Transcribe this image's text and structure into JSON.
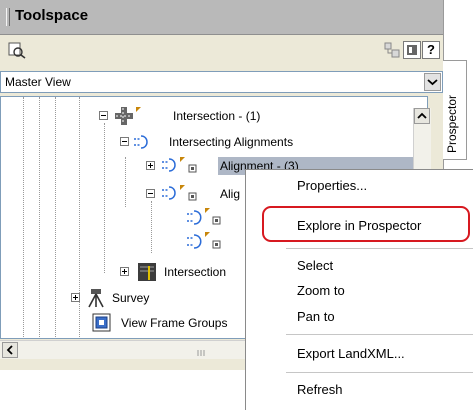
{
  "window": {
    "title": "Toolspace"
  },
  "toolbar": {
    "items": [
      "find-icon",
      "drawing-item-icon",
      "panel-icon",
      "help-icon"
    ],
    "help_label": "?"
  },
  "view_select": {
    "value": "Master View"
  },
  "tabs": {
    "prospector": "Prospector"
  },
  "tree": {
    "items": [
      {
        "label": "Intersection - (1)",
        "icon": "intersection-icon"
      },
      {
        "label": "Intersecting Alignments",
        "icon": "alignment-group-icon"
      },
      {
        "label": "Alignment - (3)",
        "icon": "alignment-icon"
      },
      {
        "label": "Alig",
        "icon": "alignment-icon"
      },
      {
        "label": "",
        "icon": "alignment-icon"
      },
      {
        "label": "",
        "icon": "alignment-icon"
      },
      {
        "label": "Intersection",
        "icon": "intersection-corridor-icon"
      },
      {
        "label": "Survey",
        "icon": "survey-icon"
      },
      {
        "label": "View Frame Groups",
        "icon": "view-frame-icon"
      }
    ]
  },
  "context_menu": {
    "items": [
      "Properties...",
      "Explore in Prospector",
      "Select",
      "Zoom to",
      "Pan to",
      "Export LandXML...",
      "Refresh"
    ],
    "highlighted": "Explore in Prospector"
  },
  "colors": {
    "highlight_border": "#d71920",
    "selection": "#aeb7c6",
    "titlebar": "#b9b9b9"
  }
}
